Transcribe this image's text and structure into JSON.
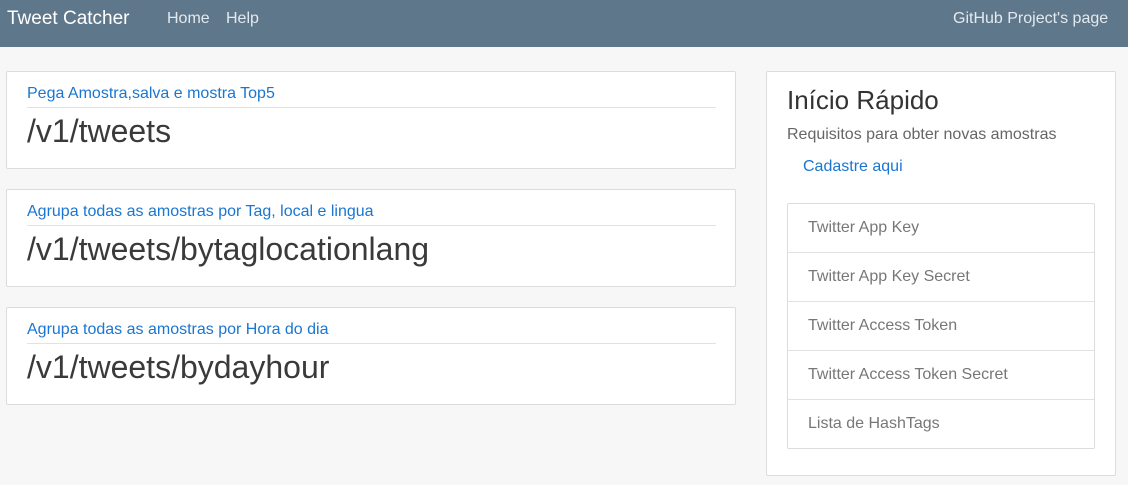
{
  "navbar": {
    "brand": "Tweet Catcher",
    "links": [
      "Home",
      "Help"
    ],
    "right_link": "GitHub Project's page"
  },
  "endpoints": [
    {
      "description": "Pega Amostra,salva e mostra Top5",
      "path": "/v1/tweets"
    },
    {
      "description": "Agrupa todas as amostras por Tag, local e lingua",
      "path": "/v1/tweets/bytaglocationlang"
    },
    {
      "description": "Agrupa todas as amostras por Hora do dia",
      "path": "/v1/tweets/bydayhour"
    }
  ],
  "quick_start": {
    "title": "Início Rápido",
    "subtitle": "Requisitos para obter novas amostras",
    "signup_link": "Cadastre aqui",
    "items": [
      "Twitter App Key",
      "Twitter App Key Secret",
      "Twitter Access Token",
      "Twitter Access Token Secret",
      "Lista de HashTags"
    ]
  }
}
